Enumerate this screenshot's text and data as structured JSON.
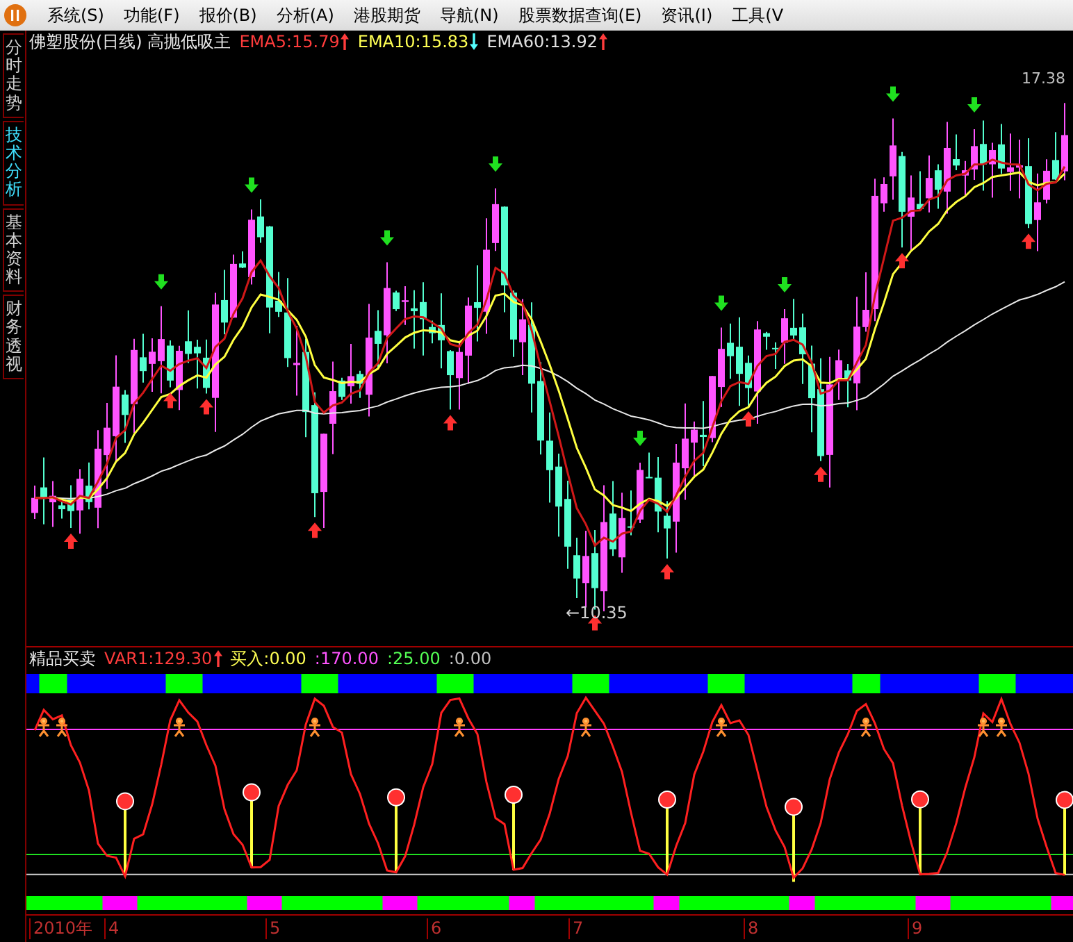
{
  "menu": [
    {
      "label": "系统(S)"
    },
    {
      "label": "功能(F)"
    },
    {
      "label": "报价(B)"
    },
    {
      "label": "分析(A)"
    },
    {
      "label": "港股期货"
    },
    {
      "label": "导航(N)"
    },
    {
      "label": "股票数据查询(E)"
    },
    {
      "label": "资讯(I)"
    },
    {
      "label": "工具(V"
    }
  ],
  "side_tabs": [
    {
      "label": "分时走势",
      "selected": false
    },
    {
      "label": "技术分析",
      "selected": true
    },
    {
      "label": "基本资料",
      "selected": false
    },
    {
      "label": "财务透视",
      "selected": false
    }
  ],
  "chart_header": {
    "title": "佛塑股份(日线) 高抛低吸主",
    "indicators": [
      {
        "text": "EMA5:15.79",
        "color": "#ff3c3c",
        "rising": true
      },
      {
        "text": "EMA10:15.83",
        "color": "#ffff54",
        "rising": false
      },
      {
        "text": "EMA60:13.92",
        "color": "#e0e0e0",
        "rising": true
      }
    ]
  },
  "high_label": "17.38",
  "low_label": "←10.35",
  "indicator_header": {
    "title": "精品买卖",
    "values": [
      {
        "text": "VAR1:129.30",
        "color": "#ff3c3c",
        "rising": true
      },
      {
        "text": "买入:0.00",
        "color": "#ffff54"
      },
      {
        "text": ":170.00",
        "color": "#ff54ff"
      },
      {
        "text": ":25.00",
        "color": "#54ff54"
      },
      {
        "text": ":0.00",
        "color": "#c0c0c0"
      }
    ]
  },
  "time_axis": [
    "2010年",
    "4",
    "5",
    "6",
    "7",
    "8",
    "9"
  ]
}
